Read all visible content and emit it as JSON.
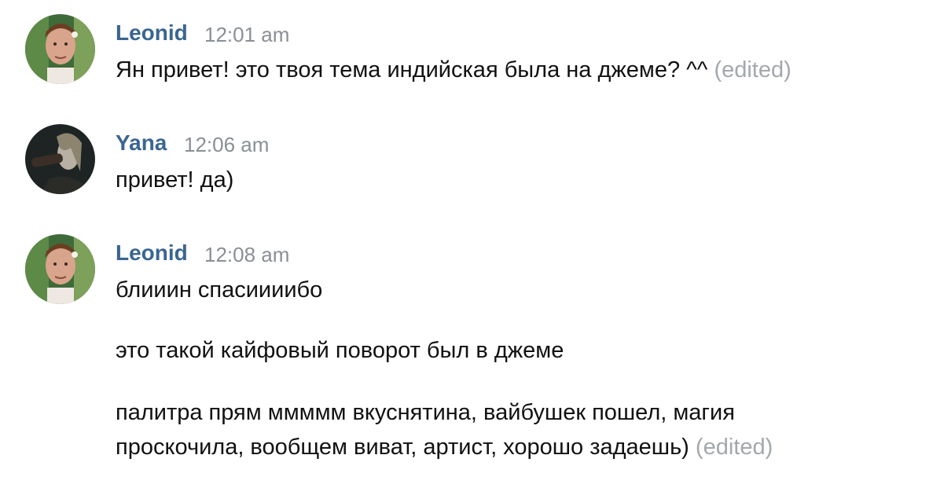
{
  "messages": [
    {
      "author": "Leonid",
      "time": "12:01 am",
      "lines": [
        "Ян привет! это твоя тема индийская была на джеме? ^^"
      ],
      "edited": "(edited)"
    },
    {
      "author": "Yana",
      "time": "12:06 am",
      "lines": [
        "привет! да)"
      ]
    },
    {
      "author": "Leonid",
      "time": "12:08 am",
      "lines": [
        "блииин спасиииибо",
        "это такой кайфовый поворот был в джеме",
        "палитра прям ммммм вкуснятина, вайбушек пошел, магия",
        "проскочила, вообщем виват, артист, хорошо задаешь)"
      ],
      "edited": "(edited)"
    }
  ],
  "colors": {
    "author": "#3a6593",
    "timestamp": "#8a8f94",
    "edited": "#a3a8ad"
  },
  "icons": [
    "avatar-leonid",
    "avatar-yana"
  ]
}
